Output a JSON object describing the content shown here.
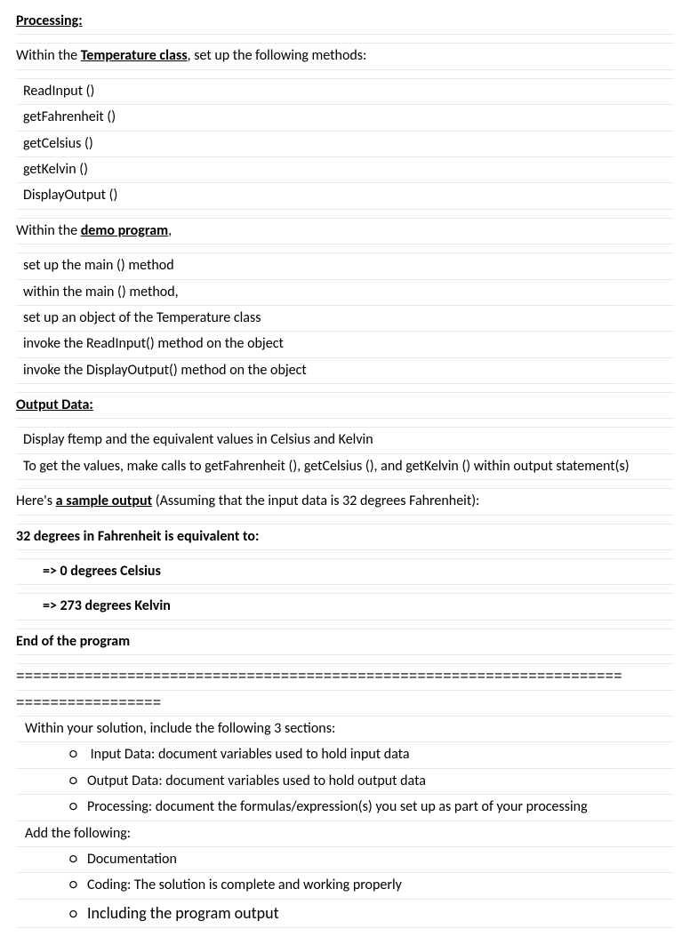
{
  "heading_processing": "Processing:",
  "intro_line_1a": "Within the ",
  "intro_line_1b": "Temperature class",
  "intro_line_1c": ", set up the following methods:",
  "methods": [
    "ReadInput ()",
    "getFahrenheit ()",
    "getCelsius ()",
    "getKelvin ()",
    "DisplayOutput ()"
  ],
  "intro_line_2a": "Within the ",
  "intro_line_2b": "demo program",
  "intro_line_2c": ",",
  "demo_steps": [
    "set up the main () method",
    "within the main () method,",
    "set up an object of the Temperature class",
    "invoke the ReadInput() method on the object",
    "invoke the DisplayOutput() method on the object"
  ],
  "heading_output": "Output Data:",
  "output_lines": [
    "Display ftemp and the equivalent values in Celsius and Kelvin",
    "To get the values, make calls to getFahrenheit (), getCelsius (), and getKelvin () within output statement(s)"
  ],
  "sample_intro_a": "Here's ",
  "sample_intro_b": "a sample output",
  "sample_intro_c": " (Assuming that the input data is 32 degrees Fahrenheit):",
  "sample_lines": [
    "32 degrees in Fahrenheit is equivalent to:",
    "=> 0 degrees Celsius",
    "=> 273 degrees Kelvin",
    "End of the program"
  ],
  "separator1": "=======================================================================",
  "separator2": "=================",
  "solution_intro": "Within your solution, include the following 3 sections:",
  "solution_bullets": [
    "Input Data: document variables used to hold input data",
    "Output Data: document variables used to hold output data",
    "Processing: document the formulas/expression(s) you set up as part of your processing"
  ],
  "add_following": "Add the following:",
  "add_bullets": [
    "Documentation",
    "Coding: The solution is complete and working properly",
    "Including the program output"
  ],
  "bullet_char": "○"
}
